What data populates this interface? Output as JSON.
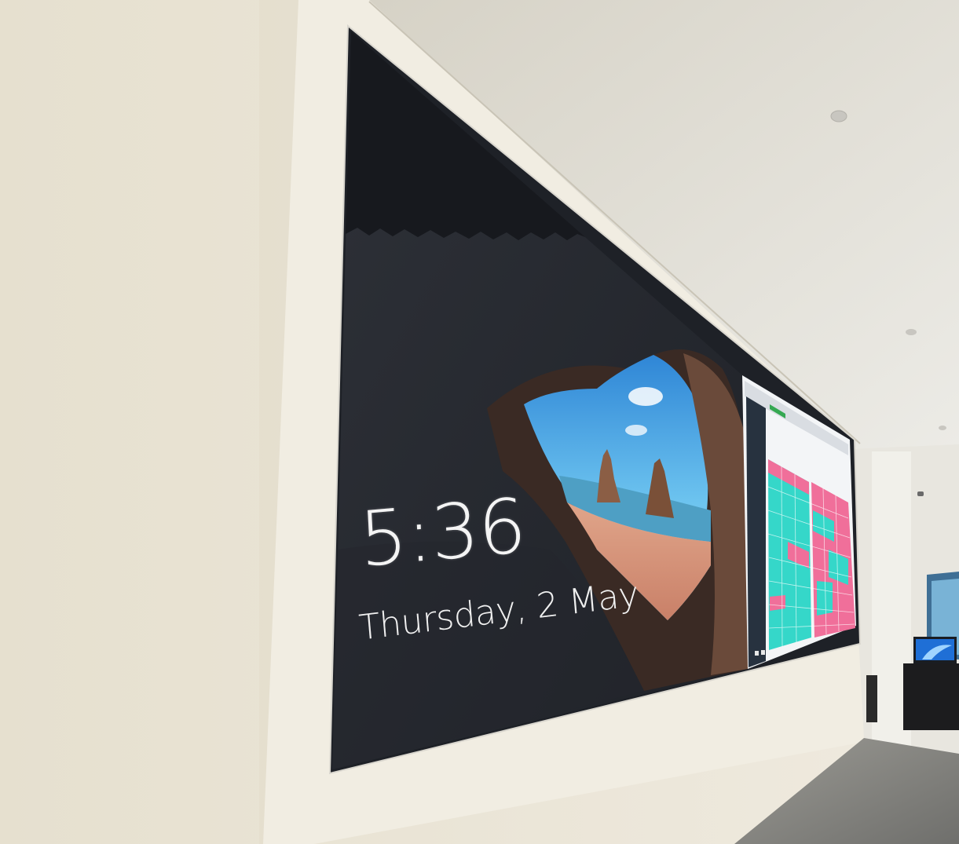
{
  "lock_screen": {
    "time": "5:36",
    "date": "Thursday, 2 May"
  },
  "colors": {
    "wall": "#e9e4d6",
    "ceiling": "#ddd9cf",
    "screen_dark": "#2b2f36",
    "sky": "#3f9be0",
    "sand": "#d89578",
    "dashboard_pink": "#f06f9a",
    "dashboard_cyan": "#35d7c9",
    "floor": "#8a8a86"
  },
  "icons": [
    "ceiling-light-icon",
    "monitor-icon",
    "camera-icon"
  ]
}
